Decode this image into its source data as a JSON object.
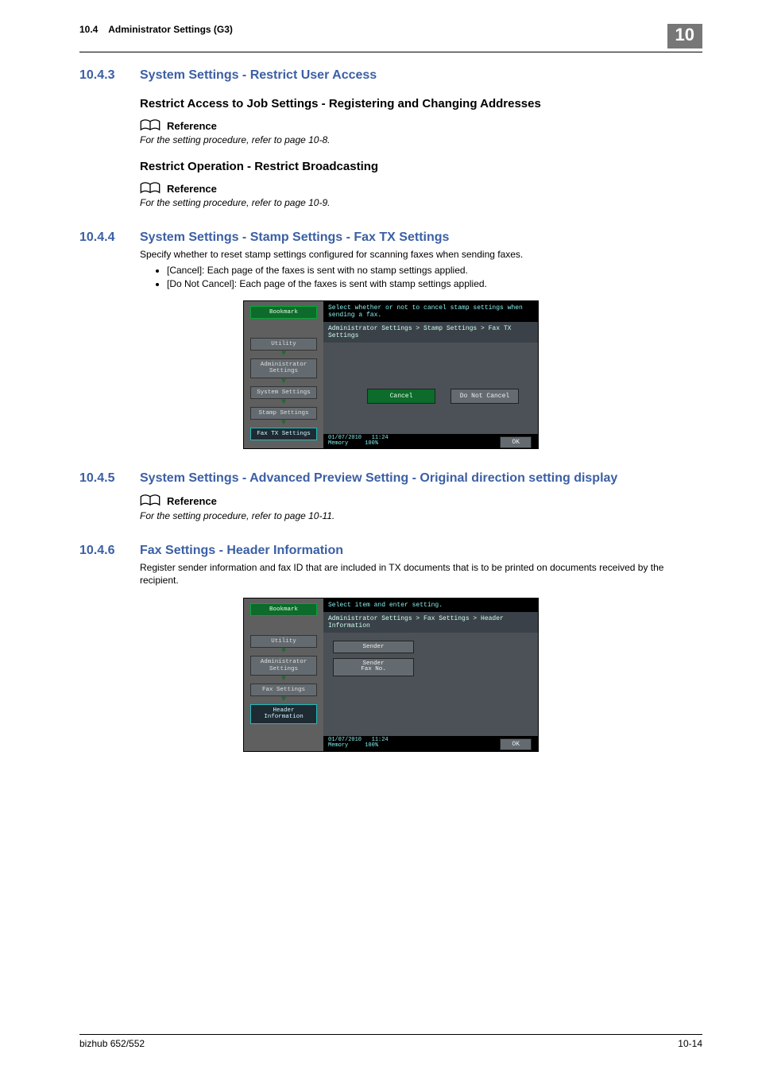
{
  "header": {
    "section_ref": "10.4",
    "title": "Administrator Settings (G3)",
    "chapter": "10"
  },
  "s1043": {
    "num": "10.4.3",
    "title": "System Settings - Restrict User Access",
    "sub1": "Restrict Access to Job Settings - Registering and Changing Addresses",
    "ref_label": "Reference",
    "ref_text1": "For the setting procedure, refer to page 10-8.",
    "sub2": "Restrict Operation - Restrict Broadcasting",
    "ref_text2": "For the setting procedure, refer to page 10-9."
  },
  "s1044": {
    "num": "10.4.4",
    "title": "System Settings - Stamp Settings - Fax TX Settings",
    "desc": "Specify whether to reset stamp settings configured for scanning faxes when sending faxes.",
    "b1": "[Cancel]: Each page of the faxes is sent with no stamp settings applied.",
    "b2": "[Do Not Cancel]: Each page of the faxes is sent with stamp settings applied."
  },
  "shot1": {
    "top": "Select whether or not to cancel stamp settings when sending a fax.",
    "bread": "Administrator Settings > Stamp Settings > Fax TX Settings",
    "side": {
      "bookmark": "Bookmark",
      "utility": "Utility",
      "admin": "Administrator\nSettings",
      "sys": "System Settings",
      "stamp": "Stamp Settings",
      "fax": "Fax TX Settings"
    },
    "cancel": "Cancel",
    "nocancel": "Do Not Cancel",
    "date": "01/07/2010",
    "time": "11:24",
    "memlabel": "Memory",
    "mem": "100%",
    "ok": "OK"
  },
  "s1045": {
    "num": "10.4.5",
    "title": "System Settings - Advanced Preview Setting - Original direction setting display",
    "ref_label": "Reference",
    "ref_text": "For the setting procedure, refer to page 10-11."
  },
  "s1046": {
    "num": "10.4.6",
    "title": "Fax Settings - Header Information",
    "desc": "Register sender information and fax ID that are included in TX documents that is to be printed on documents received by the recipient."
  },
  "shot2": {
    "top": "Select item and enter setting.",
    "bread": "Administrator Settings  > Fax Settings  > Header Information",
    "side": {
      "bookmark": "Bookmark",
      "utility": "Utility",
      "admin": "Administrator\nSettings",
      "fax": "Fax Settings",
      "header": "Header\nInformation"
    },
    "sender": "Sender",
    "faxno": "Sender\nFax No.",
    "date": "01/07/2010",
    "time": "11:24",
    "memlabel": "Memory",
    "mem": "100%",
    "ok": "OK"
  },
  "footer": {
    "product": "bizhub 652/552",
    "page": "10-14"
  }
}
